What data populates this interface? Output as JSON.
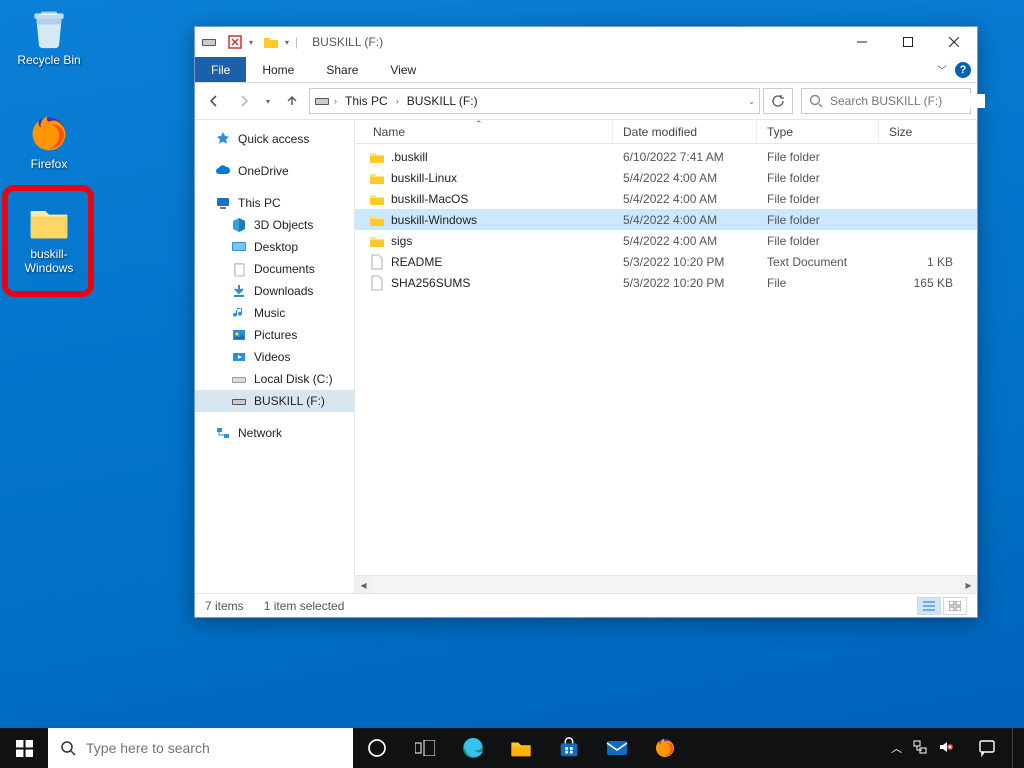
{
  "desktop": {
    "recycle_bin": "Recycle Bin",
    "firefox": "Firefox",
    "buskill_folder": "buskill-Windows"
  },
  "window": {
    "title": "BUSKILL (F:)",
    "tabs": {
      "file": "File",
      "home": "Home",
      "share": "Share",
      "view": "View"
    },
    "breadcrumb": {
      "pc": "This PC",
      "drive": "BUSKILL (F:)"
    },
    "search_placeholder": "Search BUSKILL (F:)",
    "columns": {
      "name": "Name",
      "date": "Date modified",
      "type": "Type",
      "size": "Size"
    },
    "nav": {
      "quick_access": "Quick access",
      "onedrive": "OneDrive",
      "this_pc": "This PC",
      "objects3d": "3D Objects",
      "desktop": "Desktop",
      "documents": "Documents",
      "downloads": "Downloads",
      "music": "Music",
      "pictures": "Pictures",
      "videos": "Videos",
      "local_disk": "Local Disk (C:)",
      "buskill_drive": "BUSKILL (F:)",
      "network": "Network"
    },
    "rows": [
      {
        "name": ".buskill",
        "date": "6/10/2022 7:41 AM",
        "type": "File folder",
        "size": "",
        "icon": "folder",
        "selected": false
      },
      {
        "name": "buskill-Linux",
        "date": "5/4/2022 4:00 AM",
        "type": "File folder",
        "size": "",
        "icon": "folder",
        "selected": false
      },
      {
        "name": "buskill-MacOS",
        "date": "5/4/2022 4:00 AM",
        "type": "File folder",
        "size": "",
        "icon": "folder",
        "selected": false
      },
      {
        "name": "buskill-Windows",
        "date": "5/4/2022 4:00 AM",
        "type": "File folder",
        "size": "",
        "icon": "folder",
        "selected": true
      },
      {
        "name": "sigs",
        "date": "5/4/2022 4:00 AM",
        "type": "File folder",
        "size": "",
        "icon": "folder",
        "selected": false
      },
      {
        "name": "README",
        "date": "5/3/2022 10:20 PM",
        "type": "Text Document",
        "size": "1 KB",
        "icon": "file",
        "selected": false
      },
      {
        "name": "SHA256SUMS",
        "date": "5/3/2022 10:20 PM",
        "type": "File",
        "size": "165 KB",
        "icon": "file",
        "selected": false
      }
    ],
    "status": {
      "count": "7 items",
      "selection": "1 item selected"
    }
  },
  "taskbar": {
    "search_placeholder": "Type here to search"
  }
}
